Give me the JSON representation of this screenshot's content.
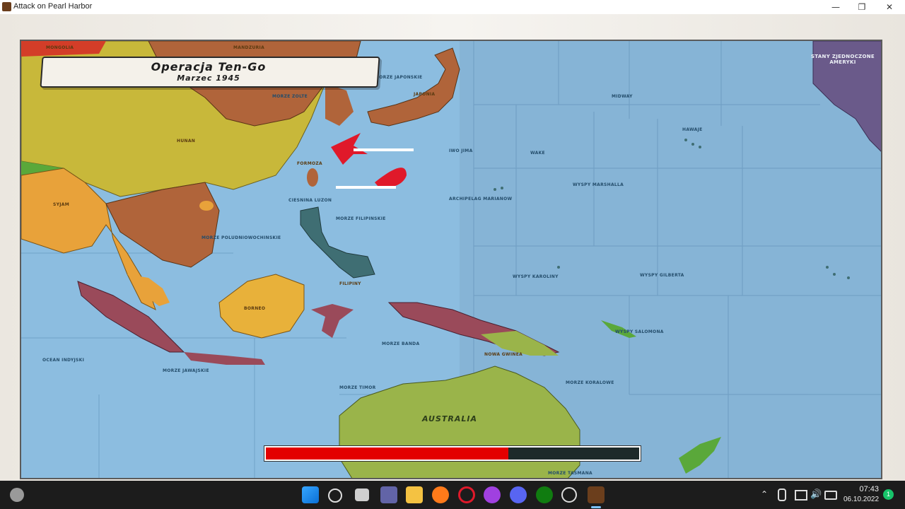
{
  "window": {
    "title": "Attack on Pearl Harbor",
    "icon": "game-icon",
    "controls": [
      "minimize-icon",
      "restore-icon",
      "close-icon"
    ]
  },
  "banner": {
    "title": "Operacja Ten-Go",
    "subtitle": "Marzec 1945"
  },
  "map": {
    "labels": {
      "australia": "AUSTRALIA",
      "usa": "STANY ZJEDNOCZONE AMERYKI",
      "japonia": "JAPONIA",
      "filipiny": "FILIPINY",
      "borneo": "BORNEO",
      "morze_filipinskie": "MORZE FILIPINSKIE",
      "morze_japonskie": "MORZE JAPONSKIE",
      "morze_zolte": "MORZE ZOLTE",
      "cieśnina_luzon": "CIESNINA LUZON",
      "mongolia": "MONGOLIA",
      "mandzuria": "MANDZURIA",
      "hunan": "HUNAN",
      "syjam": "SYJAM",
      "formoza": "FORMOZA",
      "morze_koralowe": "MORZE KORALOWE",
      "morze_tasmana": "MORZE TASMANA",
      "ocean_indyjski": "OCEAN INDYJSKI",
      "hawaje": "HAWAJE",
      "midway": "MIDWAY",
      "wake": "WAKE",
      "iwo_jima": "IWO JIMA",
      "archipelag_marianow": "ARCHIPELAG MARIANOW",
      "marshall": "WYSPY MARSHALLA",
      "wyspy_karoliny": "WYSPY KAROLINY",
      "gilbert": "WYSPY GILBERTA",
      "salomona": "WYSPY SALOMONA",
      "nowa_gwinea": "NOWA GWINEA",
      "morze_poludniowochinskie": "MORZE POLUDNIOWOCHINSKIE",
      "morze_jawajskie": "MORZE JAWAJSKIE",
      "morze_timor": "MORZE TIMOR",
      "morze_banda": "MORZE BANDA"
    },
    "colors": {
      "ocean": "#7fb3d9",
      "china_yellow": "#c8b83a",
      "japan_brown": "#b0643a",
      "siam_orange": "#e8a23a",
      "australia_green": "#9ab44a",
      "usa_purple": "#6a5a8a",
      "attack_red": "#e0192a"
    }
  },
  "progress": {
    "value": 0.65,
    "fill_color": "#e30000"
  },
  "taskbar": {
    "icons": [
      "windows-start-icon",
      "search-icon",
      "task-view-icon",
      "teams-icon",
      "file-explorer-icon",
      "firefox-icon",
      "opera-icon",
      "messenger-icon",
      "discord-icon",
      "xbox-icon",
      "chrome-icon",
      "game-taskbar-icon"
    ],
    "tray": [
      "chevron-up-icon",
      "microphone-icon",
      "network-icon",
      "volume-icon",
      "battery-icon"
    ],
    "time": "07:43",
    "date": "06.10.2022",
    "notification_count": "1"
  }
}
